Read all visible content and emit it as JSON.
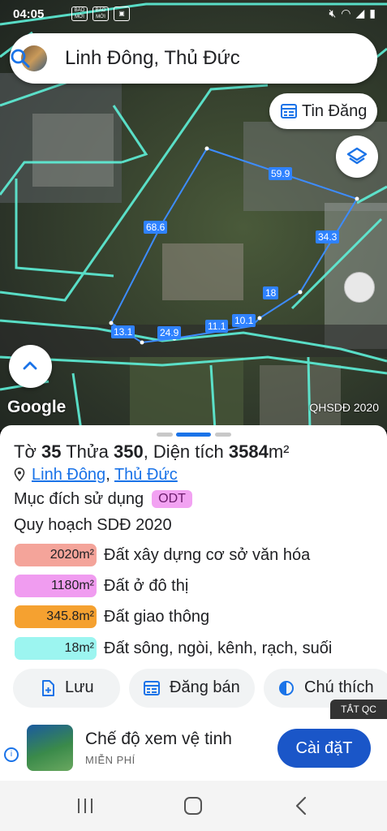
{
  "status_bar": {
    "time": "04:05",
    "left_icons": [
      "BÁO MỚI",
      "BÁO MỚI",
      "image-icon"
    ],
    "right_icons": [
      "mute-icon",
      "wifi-icon",
      "signal-icon",
      "battery-icon"
    ]
  },
  "search": {
    "title": "Linh Đông, Thủ Đức"
  },
  "tin_dang": {
    "label": "Tin Đăng"
  },
  "map": {
    "dimensions": [
      "59.9",
      "68.6",
      "34.3",
      "18",
      "10.1",
      "11.1",
      "24.9",
      "13.1"
    ],
    "google": "Google",
    "layer_name": "QHSDĐ 2020",
    "boundary_color": "#3d8cff",
    "parcel_line_color": "#5ef0d8"
  },
  "parcel": {
    "prefix_to": "Tờ",
    "to_number": "35",
    "prefix_thua": "Thửa",
    "thua_number": "350",
    "area_label": ", Diện tích",
    "area_value": "3584",
    "area_unit": "m²",
    "ward": "Linh Đông",
    "separator": ",",
    "district": "Thủ Đức",
    "purpose_label": "Mục đích sử dụng",
    "purpose_code": "ODT",
    "plan_label": "Quy hoạch SDĐ 2020"
  },
  "zones": [
    {
      "area": "2020m²",
      "desc": "Đất xây dựng cơ sở văn hóa",
      "color": "#f4a49a"
    },
    {
      "area": "1180m²",
      "desc": "Đất ở đô thị",
      "color": "#f09cf0"
    },
    {
      "area": "345.8m²",
      "desc": "Đất giao thông",
      "color": "#f5a130"
    },
    {
      "area": "18m²",
      "desc": "Đất sông, ngòi, kênh, rạch, suối",
      "color": "#9cf5f0"
    }
  ],
  "actions": {
    "save": "Lưu",
    "post": "Đăng bán",
    "legend": "Chú thích"
  },
  "ad": {
    "close_label": "TẮT QC",
    "app_name": "Chế độ xem vệ tinh",
    "price": "MIỄN PHÍ",
    "install": "Cài đặT"
  },
  "accent_color": "#1a73e8"
}
